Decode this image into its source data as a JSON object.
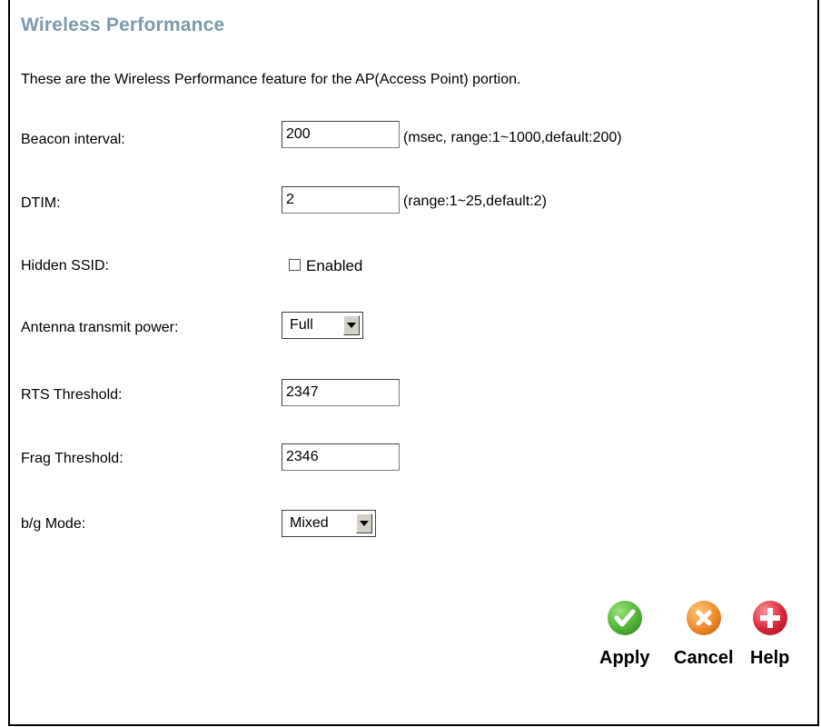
{
  "page": {
    "title": "Wireless Performance",
    "intro": "These are the Wireless Performance feature for the AP(Access Point) portion."
  },
  "form": {
    "beacon": {
      "label": "Beacon interval:",
      "value": "200",
      "hint": "(msec, range:1~1000,default:200)"
    },
    "dtim": {
      "label": "DTIM:",
      "value": "2",
      "hint": "(range:1~25,default:2)"
    },
    "hidden_ssid": {
      "label": "Hidden SSID:",
      "checkbox_label": "Enabled",
      "checked": false
    },
    "antenna": {
      "label": "Antenna transmit power:",
      "value": "Full"
    },
    "rts": {
      "label": "RTS Threshold:",
      "value": "2347"
    },
    "frag": {
      "label": "Frag Threshold:",
      "value": "2346"
    },
    "bg_mode": {
      "label": "b/g Mode:",
      "value": "Mixed"
    }
  },
  "actions": {
    "apply": {
      "label": "Apply",
      "icon": "check-icon",
      "color": "#4fb336"
    },
    "cancel": {
      "label": "Cancel",
      "icon": "x-icon",
      "color": "#ef8a2a"
    },
    "help": {
      "label": "Help",
      "icon": "plus-icon",
      "color": "#d8263a"
    }
  }
}
